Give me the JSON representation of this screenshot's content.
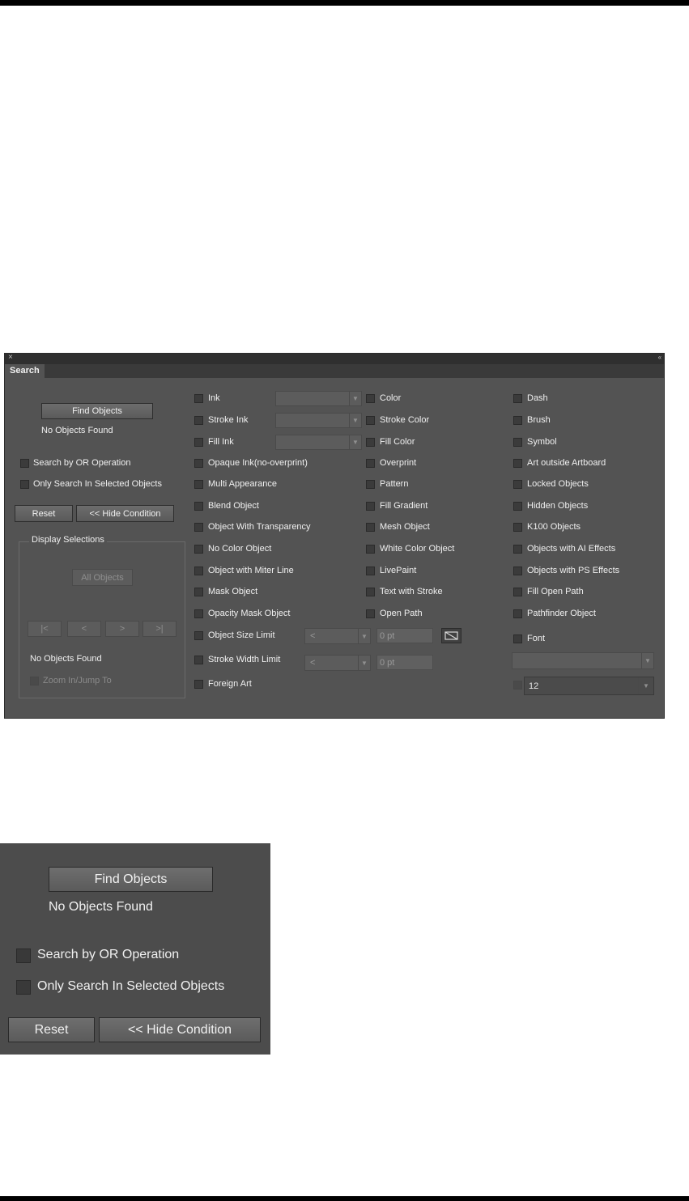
{
  "panel": {
    "close_glyph": "×",
    "collapse_glyph": "‹‹",
    "tab": "Search",
    "find_objects": "Find Objects",
    "status": "No Objects Found",
    "search_by_or": "Search by OR Operation",
    "only_selected": "Only Search In Selected Objects",
    "reset": "Reset",
    "hide_condition": "<< Hide Condition",
    "display_selections": {
      "legend": "Display Selections",
      "all_objects": "All Objects",
      "first": "|<",
      "prev": "<",
      "next": ">",
      "last": ">|",
      "status": "No Objects Found",
      "zoom_jump": "Zoom In/Jump To"
    },
    "col2": [
      "Ink",
      "Stroke Ink",
      "Fill Ink",
      "Opaque Ink(no-overprint)",
      "Multi Appearance",
      "Blend Object",
      "Object With Transparency",
      "No Color Object",
      "Object with Miter Line",
      "Mask Object",
      "Opacity Mask Object",
      "Object Size Limit",
      "Stroke Width Limit",
      "Foreign Art"
    ],
    "col3": [
      "Color",
      "Stroke Color",
      "Fill Color",
      "Overprint",
      "Pattern",
      "Fill Gradient",
      "Mesh Object",
      "White Color Object",
      "LivePaint",
      "Text with Stroke",
      "Open Path"
    ],
    "col4": [
      "Dash",
      "Brush",
      "Symbol",
      "Art outside Artboard",
      "Locked Objects",
      "Hidden Objects",
      "K100 Objects",
      "Objects with AI Effects",
      "Objects with PS Effects",
      "Fill Open Path",
      "Pathfinder Object",
      "Font"
    ],
    "size_operator": "<",
    "size_value": "0 pt",
    "stroke_operator": "<",
    "stroke_value": "0 pt",
    "font_size": "12",
    "dropdown_arrow": "▼"
  },
  "zoom": {
    "find_objects": "Find Objects",
    "status": "No Objects Found",
    "search_by_or": "Search by OR Operation",
    "only_selected": "Only Search In Selected Objects",
    "reset": "Reset",
    "hide_condition": "<< Hide Condition"
  }
}
